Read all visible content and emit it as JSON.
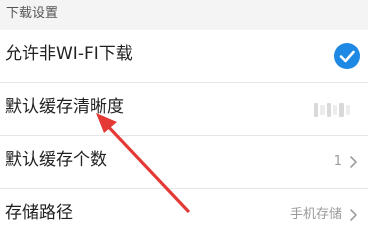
{
  "section": {
    "title": "下载设置"
  },
  "rows": [
    {
      "label": "允许非WI-FI下载",
      "checked": true
    },
    {
      "label": "默认缓存清晰度"
    },
    {
      "label": "默认缓存个数",
      "value": "1"
    },
    {
      "label": "存储路径",
      "value": "手机存储"
    }
  ],
  "icons": {
    "check": "check-circle-icon",
    "chevron": "chevron-right-icon",
    "annotation": "red-arrow-annotation"
  },
  "colors": {
    "accent": "#1e88e5",
    "annotation": "#e53935",
    "header_bg": "#f4f4f4"
  }
}
